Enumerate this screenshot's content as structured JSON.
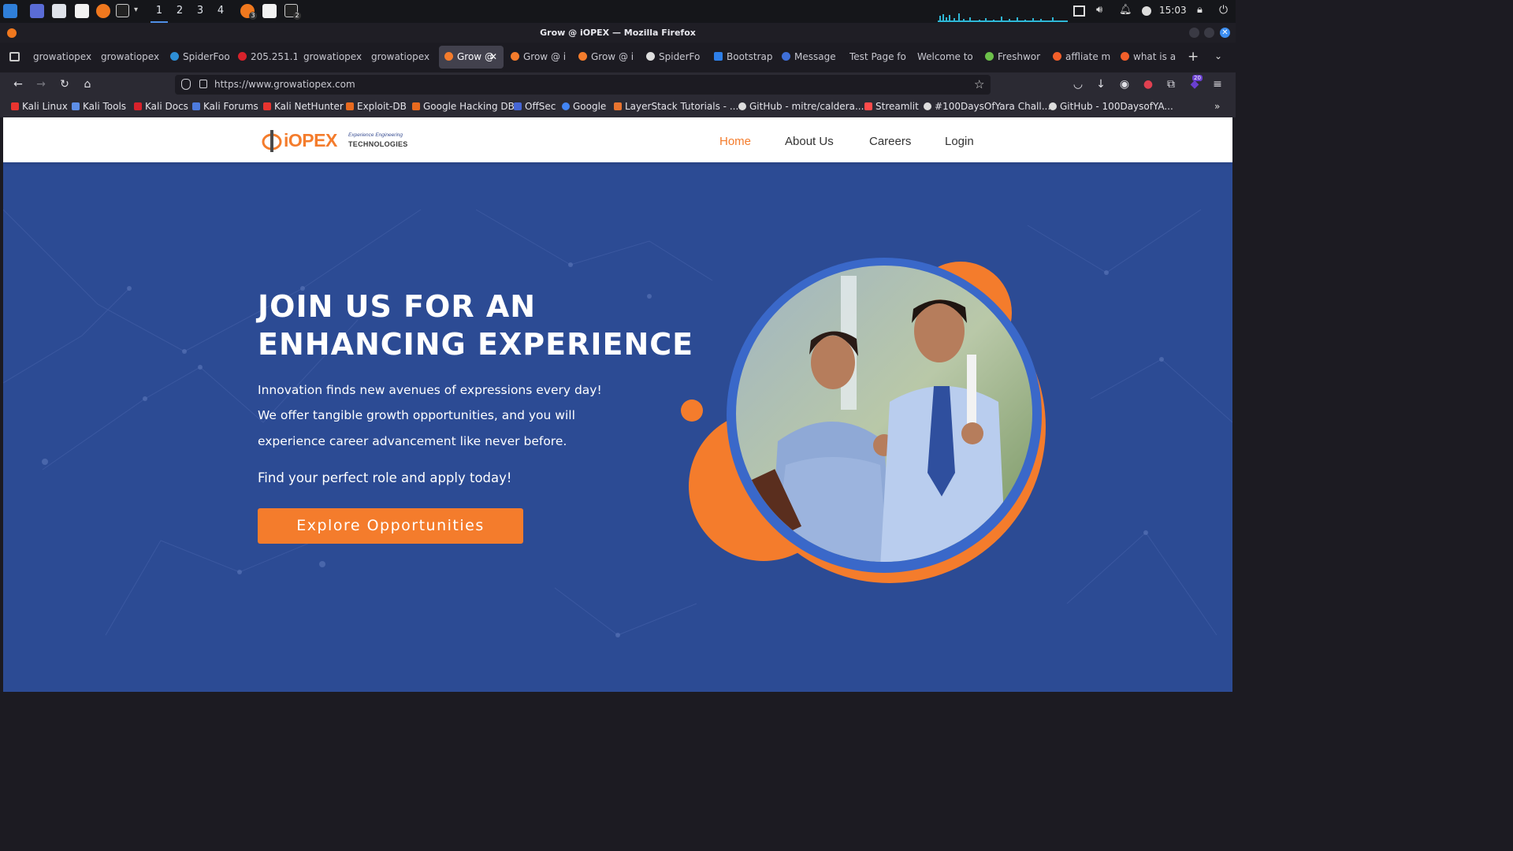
{
  "os": {
    "workspaces": [
      "1",
      "2",
      "3",
      "4"
    ],
    "active_workspace": "1",
    "clock": "15:03",
    "firefox_badge": "3",
    "terminal_badge": "2"
  },
  "window": {
    "title": "Grow @ iOPEX — Mozilla Firefox"
  },
  "tabs": [
    {
      "label": "growatiopex",
      "icon": "none"
    },
    {
      "label": "growatiopex",
      "icon": "none"
    },
    {
      "label": "SpiderFoot",
      "icon": "spider-icon"
    },
    {
      "label": "205.251.1",
      "icon": "red-circle-icon"
    },
    {
      "label": "growatiopex",
      "icon": "none"
    },
    {
      "label": "growatiopex",
      "icon": "none"
    },
    {
      "label": "Grow @",
      "icon": "iopex-icon",
      "active": true
    },
    {
      "label": "Grow @ i",
      "icon": "iopex-icon"
    },
    {
      "label": "Grow @ i",
      "icon": "iopex-icon"
    },
    {
      "label": "SpiderFo",
      "icon": "spider-icon"
    },
    {
      "label": "Bootstrap",
      "icon": "bootstrap-icon"
    },
    {
      "label": "Message",
      "icon": "message-icon"
    },
    {
      "label": "Test Page fo",
      "icon": "none"
    },
    {
      "label": "Welcome to",
      "icon": "none"
    },
    {
      "label": "Freshwor",
      "icon": "freshworks-icon"
    },
    {
      "label": "affliate m",
      "icon": "brave-icon"
    },
    {
      "label": "what is af",
      "icon": "brave-icon"
    }
  ],
  "url": "https://www.growatiopex.com",
  "extension_badge": "20",
  "bookmarks": [
    {
      "label": "Kali Linux",
      "color": "#e8342f"
    },
    {
      "label": "Kali Tools",
      "color": "#5d8ee6"
    },
    {
      "label": "Kali Docs",
      "color": "#d8222b"
    },
    {
      "label": "Kali Forums",
      "color": "#4d7bdd"
    },
    {
      "label": "Kali NetHunter",
      "color": "#e8342f"
    },
    {
      "label": "Exploit-DB",
      "color": "#e86a1f"
    },
    {
      "label": "Google Hacking DB",
      "color": "#e86a1f"
    },
    {
      "label": "OffSec",
      "color": "#4666d5"
    },
    {
      "label": "Google",
      "color": "#4285f4"
    },
    {
      "label": "LayerStack Tutorials - ...",
      "color": "#e8742f"
    },
    {
      "label": "GitHub - mitre/caldera...",
      "color": "#dddddd"
    },
    {
      "label": "Streamlit",
      "color": "#ff4b4b"
    },
    {
      "label": "#100DaysOfYara Chall...",
      "color": "#dddddd"
    },
    {
      "label": "GitHub - 100DaysofYA...",
      "color": "#dddddd"
    }
  ],
  "site": {
    "logo_text": "iOPEX",
    "logo_tagline": "Experience Engineering",
    "logo_sub": "TECHNOLOGIES",
    "nav": [
      "Home",
      "About Us",
      "Careers",
      "Login"
    ],
    "hero_title": "JOIN US FOR AN ENHANCING EXPERIENCE",
    "hero_lines": [
      "Innovation finds new avenues of expressions every day!",
      "We offer tangible growth opportunities, and you will",
      "experience career advancement like never before."
    ],
    "hero_cta_text": "Find your perfect role and apply today!",
    "cta_button": "Explore Opportunities",
    "colors": {
      "primary": "#2c4b94",
      "accent": "#f47c2c",
      "ring": "#3a68c9"
    }
  }
}
